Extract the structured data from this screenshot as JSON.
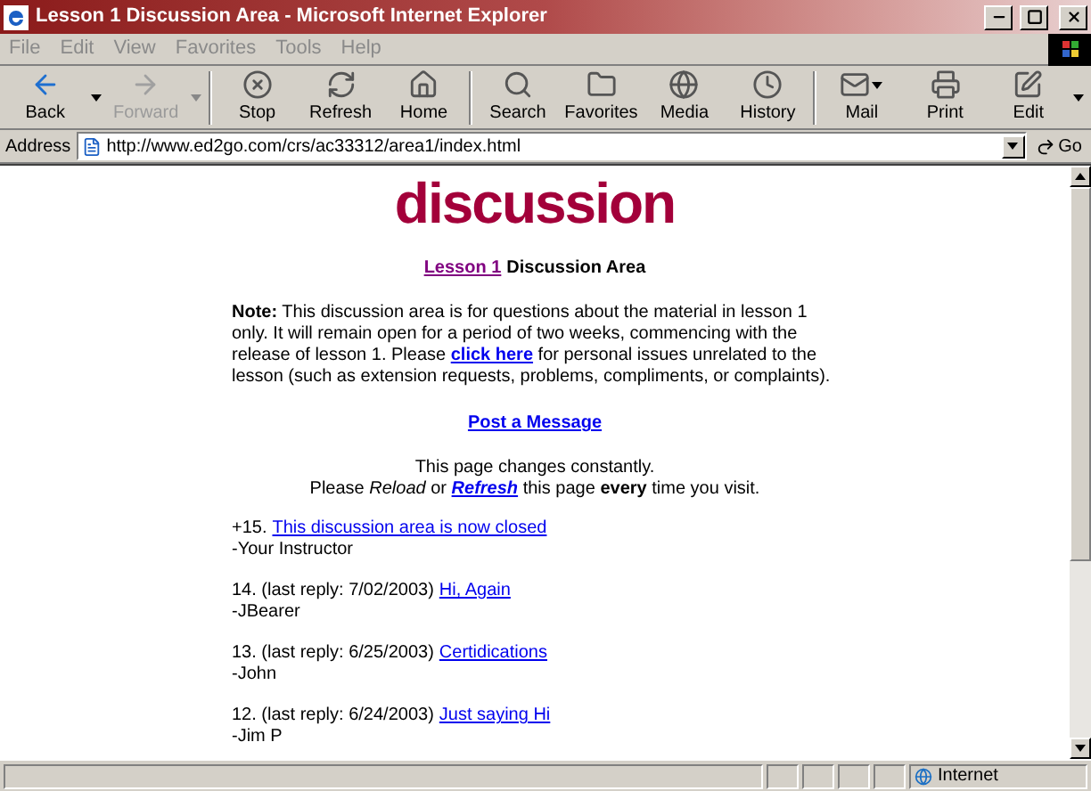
{
  "window": {
    "title": "Lesson 1 Discussion Area - Microsoft Internet Explorer"
  },
  "menu": [
    "File",
    "Edit",
    "View",
    "Favorites",
    "Tools",
    "Help"
  ],
  "toolbar": [
    {
      "label": "Back",
      "disabled": false,
      "kind": "split",
      "dropdown": true
    },
    {
      "label": "Forward",
      "disabled": true,
      "kind": "split",
      "dropdown": true
    },
    {
      "label": "Stop",
      "disabled": false,
      "kind": "split",
      "dropdown": false
    },
    {
      "label": "Refresh",
      "disabled": false,
      "kind": "split",
      "dropdown": false
    },
    {
      "label": "Home",
      "disabled": false,
      "kind": "split",
      "dropdown": false
    },
    {
      "label": "Search",
      "disabled": false,
      "kind": "split",
      "dropdown": false
    },
    {
      "label": "Favorites",
      "disabled": false,
      "kind": "split",
      "dropdown": false
    },
    {
      "label": "Media",
      "disabled": false,
      "kind": "split",
      "dropdown": false
    },
    {
      "label": "History",
      "disabled": false,
      "kind": "split",
      "dropdown": false
    },
    {
      "label": "Mail",
      "disabled": false,
      "kind": "menu",
      "dropdown": true
    },
    {
      "label": "Print",
      "disabled": false,
      "kind": "split",
      "dropdown": false
    },
    {
      "label": "Edit",
      "disabled": false,
      "kind": "split",
      "dropdown": true
    }
  ],
  "address": {
    "label": "Address",
    "value": "http://www.ed2go.com/crs/ac33312/area1/index.html",
    "go": "Go"
  },
  "page": {
    "logo": "discussion",
    "heading": {
      "link": "Lesson 1",
      "visited": true,
      "text": "Discussion Area"
    },
    "note": {
      "before": "**Note:** This discussion area is for questions about the material in lesson 1 only. It will remain open for a period of two weeks, commencing with the release of lesson 1. Please ",
      "link": "click here",
      "after": " for personal issues unrelated to the lesson (such as extension requests, problems, compliments, or complaints)."
    },
    "post_link": "Post a Message",
    "notice": {
      "line1": "This page changes constantly.",
      "before": "Please *Reload* or ",
      "link": "Refresh",
      "after": " this page **every** time you visit."
    },
    "posts": [
      {
        "prefix": "+15.",
        "title": "This discussion area is now closed",
        "author": "-Your Instructor"
      },
      {
        "prefix": "14. (last reply: 7/02/2003)",
        "title": "Hi, Again",
        "author": "-JBearer"
      },
      {
        "prefix": "13. (last reply: 6/25/2003)",
        "title": "Certidications",
        "author": "-John"
      },
      {
        "prefix": "12. (last reply: 6/24/2003)",
        "title": "Just saying Hi",
        "author": "-Jim P"
      }
    ]
  },
  "status_bar": {
    "zone": "Internet"
  }
}
